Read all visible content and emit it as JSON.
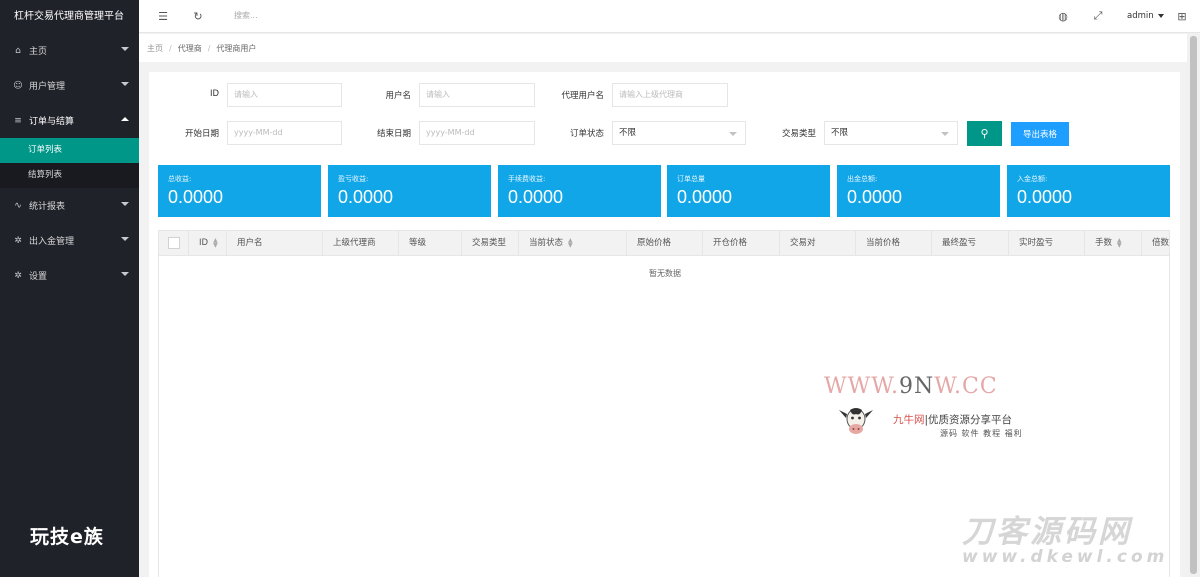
{
  "brand": "杠杆交易代理商管理平台",
  "sidebar": {
    "items": [
      {
        "label": "主页",
        "icon": "home-icon"
      },
      {
        "label": "用户管理",
        "icon": "user-icon"
      },
      {
        "label": "订单与结算",
        "icon": "list-icon"
      },
      {
        "label": "统计报表",
        "icon": "chart-icon"
      },
      {
        "label": "出入金管理",
        "icon": "gear-icon"
      },
      {
        "label": "设置",
        "icon": "settings-icon"
      }
    ],
    "sub_items": [
      "订单列表",
      "结算列表"
    ]
  },
  "header": {
    "search_placeholder": "搜索...",
    "user": "admin"
  },
  "breadcrumb": [
    "主页",
    "代理商",
    "代理商用户"
  ],
  "filters": {
    "id_label": "ID",
    "id_placeholder": "请输入",
    "username_label": "用户名",
    "username_placeholder": "请输入",
    "agent_label": "代理用户名",
    "agent_placeholder": "请输入上级代理商",
    "start_label": "开始日期",
    "start_placeholder": "yyyy-MM-dd",
    "end_label": "结束日期",
    "end_placeholder": "yyyy-MM-dd",
    "status_label": "订单状态",
    "status_value": "不限",
    "type_label": "交易类型",
    "type_value": "不限",
    "export_label": "导出表格"
  },
  "stats": [
    {
      "label": "总收益:",
      "value": "0.0000"
    },
    {
      "label": "盈亏收益:",
      "value": "0.0000"
    },
    {
      "label": "手续费收益:",
      "value": "0.0000"
    },
    {
      "label": "订单总量",
      "value": "0.0000"
    },
    {
      "label": "出金总额:",
      "value": "0.0000"
    },
    {
      "label": "入金总额:",
      "value": "0.0000"
    }
  ],
  "table": {
    "columns": [
      "ID",
      "用户名",
      "上级代理商",
      "等级",
      "交易类型",
      "当前状态",
      "原始价格",
      "开仓价格",
      "交易对",
      "当前价格",
      "最终盈亏",
      "实时盈亏",
      "手数",
      "倍数"
    ],
    "empty_text": "暂无数据"
  },
  "watermarks": {
    "url_a": "WWW.",
    "url_b": "9N",
    "url_c": "W.CC",
    "site_a": "九牛网",
    "site_b": "|优质资源分享平台",
    "site_sub": "源码 软件 教程 福利",
    "left": "玩技e族",
    "big": "刀客源码网",
    "domain": "www.dkewl.com"
  }
}
